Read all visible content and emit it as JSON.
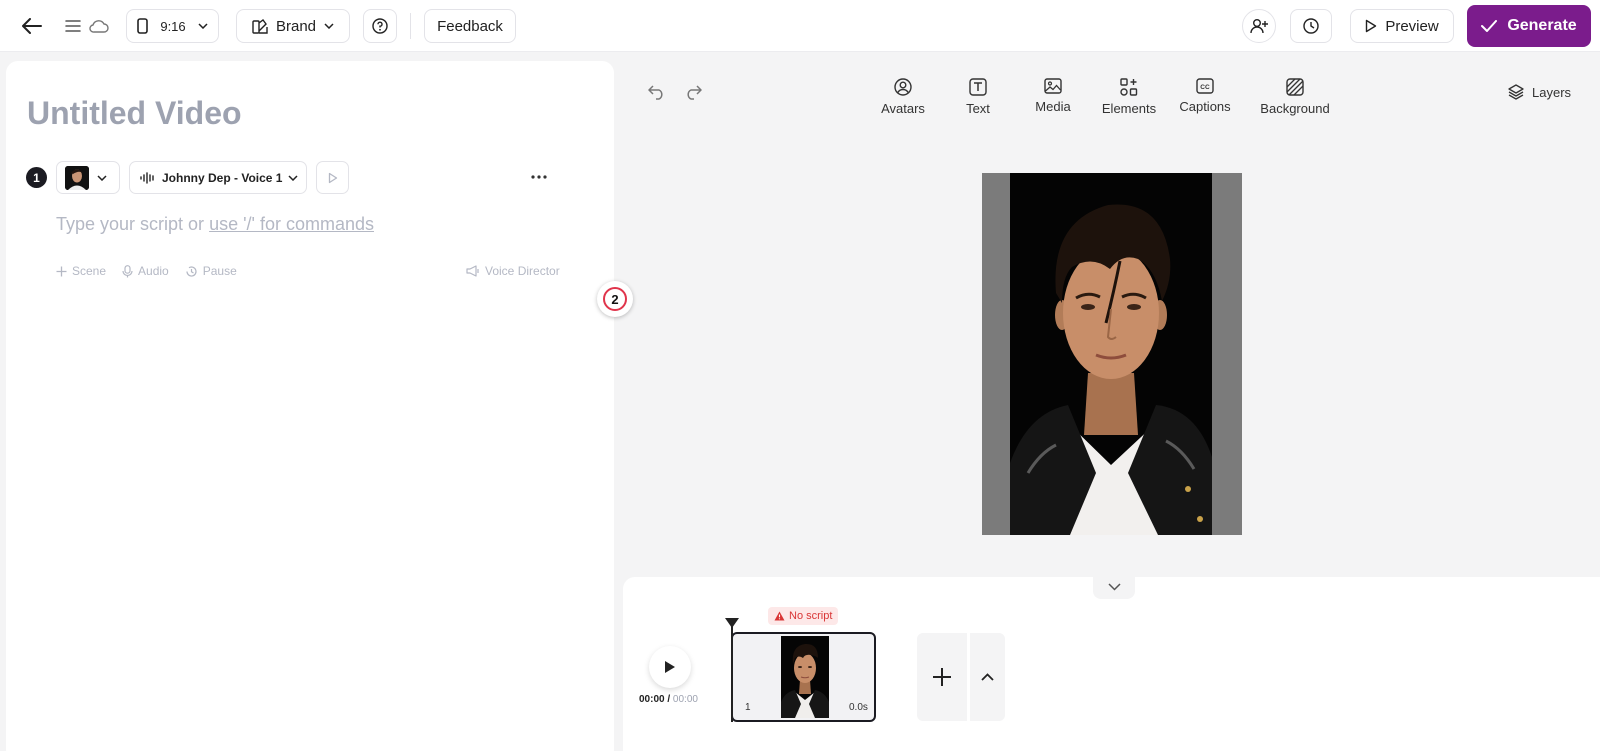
{
  "header": {
    "aspect_ratio": "9:16",
    "brand_label": "Brand",
    "feedback_label": "Feedback",
    "preview_label": "Preview",
    "generate_label": "Generate",
    "accent_color": "#7b1c8c"
  },
  "editor": {
    "title": "Untitled Video",
    "scene": {
      "number": "1",
      "voice_label": "Johnny Dep - Voice 1",
      "script_placeholder": "Type your script or ",
      "script_command_hint": "use '/' for commands",
      "actions": {
        "scene": "Scene",
        "audio": "Audio",
        "pause": "Pause",
        "voice_director": "Voice Director"
      }
    },
    "badge_number": "2"
  },
  "canvas": {
    "tools": [
      {
        "label": "Avatars",
        "icon": "avatar-icon"
      },
      {
        "label": "Text",
        "icon": "text-icon"
      },
      {
        "label": "Media",
        "icon": "media-icon"
      },
      {
        "label": "Elements",
        "icon": "elements-icon"
      },
      {
        "label": "Captions",
        "icon": "captions-icon"
      },
      {
        "label": "Background",
        "icon": "background-icon"
      }
    ],
    "layers_label": "Layers"
  },
  "timeline": {
    "current_time": "00:00",
    "separator": " / ",
    "total_time": "00:00",
    "warning": "No script",
    "clip": {
      "index": "1",
      "duration": "0.0s"
    }
  }
}
